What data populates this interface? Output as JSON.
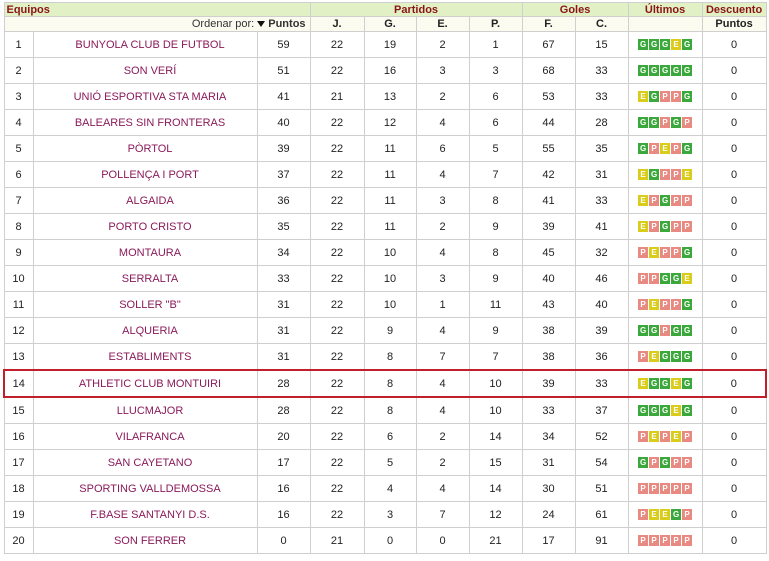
{
  "header": {
    "equipos": "Equipos",
    "partidos": "Partidos",
    "goles": "Goles",
    "ultimos": "Últimos",
    "descuento": "Descuento",
    "order_label": "Ordenar por:",
    "puntos": "Puntos",
    "j": "J.",
    "g": "G.",
    "e": "E.",
    "p": "P.",
    "f": "F.",
    "c": "C.",
    "desc_puntos": "Puntos"
  },
  "colors": {
    "win": "#3aa83a",
    "draw": "#d9cc1a",
    "loss": "#e88a82",
    "highlight": "#c0202a",
    "team_link": "#8a1a5a",
    "header_bg": "#e2f0c6"
  },
  "highlighted_row": 14,
  "rows": [
    {
      "pos": "1",
      "team": "BUNYOLA CLUB DE FUTBOL",
      "pts": "59",
      "j": "22",
      "g": "19",
      "e": "2",
      "p": "1",
      "f": "67",
      "c": "15",
      "form": [
        "G",
        "G",
        "G",
        "E",
        "G"
      ],
      "desc": "0"
    },
    {
      "pos": "2",
      "team": "SON VERÍ",
      "pts": "51",
      "j": "22",
      "g": "16",
      "e": "3",
      "p": "3",
      "f": "68",
      "c": "33",
      "form": [
        "G",
        "G",
        "G",
        "G",
        "G"
      ],
      "desc": "0"
    },
    {
      "pos": "3",
      "team": "UNIÓ ESPORTIVA STA MARIA",
      "pts": "41",
      "j": "21",
      "g": "13",
      "e": "2",
      "p": "6",
      "f": "53",
      "c": "33",
      "form": [
        "E",
        "G",
        "P",
        "P",
        "G"
      ],
      "desc": "0"
    },
    {
      "pos": "4",
      "team": "BALEARES SIN FRONTERAS",
      "pts": "40",
      "j": "22",
      "g": "12",
      "e": "4",
      "p": "6",
      "f": "44",
      "c": "28",
      "form": [
        "G",
        "G",
        "P",
        "G",
        "P"
      ],
      "desc": "0"
    },
    {
      "pos": "5",
      "team": "PÒRTOL",
      "pts": "39",
      "j": "22",
      "g": "11",
      "e": "6",
      "p": "5",
      "f": "55",
      "c": "35",
      "form": [
        "G",
        "P",
        "E",
        "P",
        "G"
      ],
      "desc": "0"
    },
    {
      "pos": "6",
      "team": "POLLENÇA I PORT",
      "pts": "37",
      "j": "22",
      "g": "11",
      "e": "4",
      "p": "7",
      "f": "42",
      "c": "31",
      "form": [
        "E",
        "G",
        "P",
        "P",
        "E"
      ],
      "desc": "0"
    },
    {
      "pos": "7",
      "team": "ALGAIDA",
      "pts": "36",
      "j": "22",
      "g": "11",
      "e": "3",
      "p": "8",
      "f": "41",
      "c": "33",
      "form": [
        "E",
        "P",
        "G",
        "P",
        "P"
      ],
      "desc": "0"
    },
    {
      "pos": "8",
      "team": "PORTO CRISTO",
      "pts": "35",
      "j": "22",
      "g": "11",
      "e": "2",
      "p": "9",
      "f": "39",
      "c": "41",
      "form": [
        "E",
        "P",
        "G",
        "P",
        "P"
      ],
      "desc": "0"
    },
    {
      "pos": "9",
      "team": "MONTAURA",
      "pts": "34",
      "j": "22",
      "g": "10",
      "e": "4",
      "p": "8",
      "f": "45",
      "c": "32",
      "form": [
        "P",
        "E",
        "P",
        "P",
        "G"
      ],
      "desc": "0"
    },
    {
      "pos": "10",
      "team": "SERRALTA",
      "pts": "33",
      "j": "22",
      "g": "10",
      "e": "3",
      "p": "9",
      "f": "40",
      "c": "46",
      "form": [
        "P",
        "P",
        "G",
        "G",
        "E"
      ],
      "desc": "0"
    },
    {
      "pos": "11",
      "team": "SOLLER \"B\"",
      "pts": "31",
      "j": "22",
      "g": "10",
      "e": "1",
      "p": "11",
      "f": "43",
      "c": "40",
      "form": [
        "P",
        "E",
        "P",
        "P",
        "G"
      ],
      "desc": "0"
    },
    {
      "pos": "12",
      "team": "ALQUERIA",
      "pts": "31",
      "j": "22",
      "g": "9",
      "e": "4",
      "p": "9",
      "f": "38",
      "c": "39",
      "form": [
        "G",
        "G",
        "P",
        "G",
        "G"
      ],
      "desc": "0"
    },
    {
      "pos": "13",
      "team": "ESTABLIMENTS",
      "pts": "31",
      "j": "22",
      "g": "8",
      "e": "7",
      "p": "7",
      "f": "38",
      "c": "36",
      "form": [
        "P",
        "E",
        "G",
        "G",
        "G"
      ],
      "desc": "0"
    },
    {
      "pos": "14",
      "team": "ATHLETIC CLUB MONTUIRI",
      "pts": "28",
      "j": "22",
      "g": "8",
      "e": "4",
      "p": "10",
      "f": "39",
      "c": "33",
      "form": [
        "E",
        "G",
        "G",
        "E",
        "G"
      ],
      "desc": "0"
    },
    {
      "pos": "15",
      "team": "LLUCMAJOR",
      "pts": "28",
      "j": "22",
      "g": "8",
      "e": "4",
      "p": "10",
      "f": "33",
      "c": "37",
      "form": [
        "G",
        "G",
        "G",
        "E",
        "G"
      ],
      "desc": "0"
    },
    {
      "pos": "16",
      "team": "VILAFRANCA",
      "pts": "20",
      "j": "22",
      "g": "6",
      "e": "2",
      "p": "14",
      "f": "34",
      "c": "52",
      "form": [
        "P",
        "E",
        "P",
        "E",
        "P"
      ],
      "desc": "0"
    },
    {
      "pos": "17",
      "team": "SAN CAYETANO",
      "pts": "17",
      "j": "22",
      "g": "5",
      "e": "2",
      "p": "15",
      "f": "31",
      "c": "54",
      "form": [
        "G",
        "P",
        "G",
        "P",
        "P"
      ],
      "desc": "0"
    },
    {
      "pos": "18",
      "team": "SPORTING VALLDEMOSSA",
      "pts": "16",
      "j": "22",
      "g": "4",
      "e": "4",
      "p": "14",
      "f": "30",
      "c": "51",
      "form": [
        "P",
        "P",
        "P",
        "P",
        "P"
      ],
      "desc": "0"
    },
    {
      "pos": "19",
      "team": "F.BASE SANTANYI D.S.",
      "pts": "16",
      "j": "22",
      "g": "3",
      "e": "7",
      "p": "12",
      "f": "24",
      "c": "61",
      "form": [
        "P",
        "E",
        "E",
        "G",
        "P"
      ],
      "desc": "0"
    },
    {
      "pos": "20",
      "team": "SON FERRER",
      "pts": "0",
      "j": "21",
      "g": "0",
      "e": "0",
      "p": "21",
      "f": "17",
      "c": "91",
      "form": [
        "P",
        "P",
        "P",
        "P",
        "P"
      ],
      "desc": "0"
    }
  ]
}
